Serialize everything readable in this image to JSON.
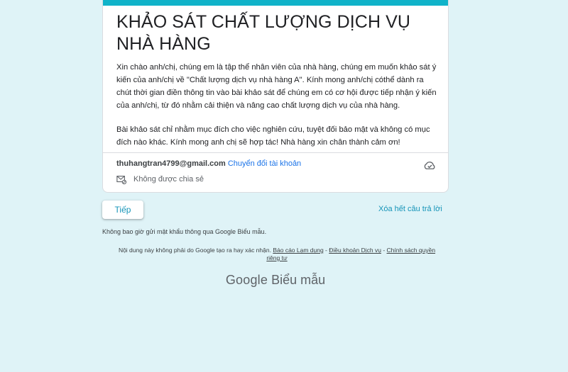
{
  "form": {
    "title": "KHẢO SÁT CHẤT LƯỢNG DỊCH VỤ NHÀ HÀNG",
    "description_1": "Xin chào anh/chị, chúng em là tập thể nhân viên của nhà hàng, chúng em muốn khảo sát ý kiến của anh/chị về \"Chất lượng dịch vụ nhà hàng A\". Kính mong anh/chị cóthể dành ra chút thời gian điền thông tin vào bài khảo sát để chúng em có cơ hội được tiếp nhận ý kiến của anh/chị, từ đó nhằm cải thiện và nâng cao chất lượng dịch vụ của nhà hàng.",
    "description_2": "Bài khảo sát chỉ nhằm mục đích cho việc nghiên cứu, tuyệt đối bảo mật và không có mục đích nào khác. Kính mong anh chị sẽ hợp tác! Nhà hàng xin chân thành cảm ơn!",
    "accent_color": "#10b3c9"
  },
  "account": {
    "email": "thuhangtran4799@gmail.com",
    "switch_label": "Chuyển đổi tài khoản",
    "share_status": "Không được chia sẻ"
  },
  "actions": {
    "next_label": "Tiếp",
    "clear_label": "Xóa hết câu trả lời"
  },
  "footer": {
    "warning": "Không bao giờ gửi mật khẩu thông qua Google Biểu mẫu.",
    "disclaimer": "Nội dung này không phải do Google tạo ra hay xác nhận.",
    "report_link": "Báo cáo Lạm dụng",
    "terms_link": "Điều khoản Dịch vụ",
    "privacy_link": "Chính sách quyền riêng tư",
    "separator": " - ",
    "logo_google": "Google",
    "logo_product": "Biểu mẫu"
  },
  "icons": {
    "cloud": "cloud-done-icon",
    "share": "not-shared-icon"
  }
}
